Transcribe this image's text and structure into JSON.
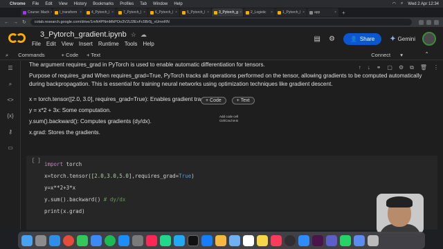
{
  "menubar": {
    "app": "Chrome",
    "items": [
      "File",
      "Edit",
      "View",
      "History",
      "Bookmarks",
      "Profiles",
      "Tab",
      "Window",
      "Help"
    ],
    "clock": "Wed 2 Apr 12:34"
  },
  "browser": {
    "tabs": [
      {
        "label": "Course: Mach"
      },
      {
        "label": "I_transform"
      },
      {
        "label": "4_Pytorch_l"
      },
      {
        "label": "7_Pytorch_l"
      },
      {
        "label": "6_Pytorch_l"
      },
      {
        "label": "5_Pytorch_l"
      },
      {
        "label": "3_Pytorch_g"
      },
      {
        "label": "2_Logistic"
      },
      {
        "label": "1_Pytorch_l"
      },
      {
        "label": "app"
      }
    ],
    "url": "colab.research.google.com/drive/1mN4PNmMkPOo3V2U2lEvFc5Br5j_vUmnRN"
  },
  "colab": {
    "notebook_title": "3_Pytorch_gradient.ipynb",
    "menus": [
      "File",
      "Edit",
      "View",
      "Insert",
      "Runtime",
      "Tools",
      "Help"
    ],
    "share_label": "Share",
    "gemini_label": "Gemini",
    "toolbar": {
      "commands": "Commands",
      "add_code": "+ Code",
      "add_text": "+ Text",
      "connect": "Connect"
    }
  },
  "text_cell": {
    "line1": "The argument requires_grad in PyTorch is used to enable automatic differentiation for tensors.",
    "line2": "Purpose of requires_grad When requires_grad=True, PyTorch tracks all operations performed on the tensor, allowing gradients to be computed automatically during backpropagation. This is essential for training neural networks using optimization techniques like gradient descent.",
    "bullet1": "x = torch.tensor([2.0, 3.0], requires_grad=True): Enables gradient tracking.",
    "bullet2": "y = x*2 + 3x: Some computation.",
    "bullet3": "y.sum().backward(): Computes gradients (dy/dx).",
    "bullet4": "x.grad: Stores the gradients."
  },
  "insert_buttons": {
    "code": "+ Code",
    "text": "+ Text",
    "tooltip_line1": "Add code cell",
    "tooltip_line2": "Ctrl/Cmd M B"
  },
  "code_cell": {
    "run_label": "[ ]",
    "lines": {
      "l1_kw": "import",
      "l1_rest": " torch",
      "l2_a": "x=torch.tensor([",
      "l2_nums": "2.0,3.0,5.0",
      "l2_b": "],requires_grad=",
      "l2_bool": "True",
      "l2_c": ")",
      "l3": "y=x**2+3*x",
      "l4_a": "y.sum().backward() ",
      "l4_cm": "# dy/dx",
      "l5": "print(x.grad)"
    }
  },
  "dock_icons": [
    "finder",
    "launchpad",
    "safari",
    "chrome",
    "messages",
    "mail",
    "spotify",
    "app-store",
    "settings",
    "intellij",
    "pycharm",
    "vscode",
    "terminal",
    "xcode",
    "photos",
    "preview",
    "calendar",
    "notes",
    "music",
    "trash"
  ]
}
